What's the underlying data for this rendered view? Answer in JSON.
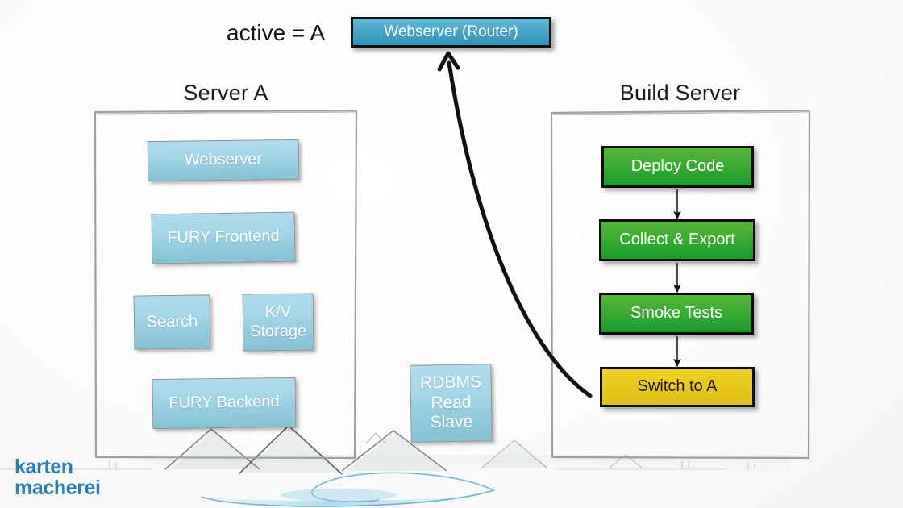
{
  "slide": {
    "annotation": "active = A",
    "logo": {
      "line1": "karten",
      "line2": "macherei",
      "color": "#2b7fae"
    }
  },
  "router": {
    "label": "Webserver (Router)",
    "fill_top": "#63b8d6",
    "fill_bottom": "#2e93b8"
  },
  "server_a": {
    "title": "Server A",
    "nodes": [
      {
        "label": "Webserver"
      },
      {
        "label": "FURY Frontend"
      },
      {
        "label": "Search"
      },
      {
        "label": "K/V\nStorage"
      },
      {
        "label": "FURY Backend"
      }
    ],
    "node_fill_top": "#aedced",
    "node_fill_bottom": "#85c2d8"
  },
  "standalone": {
    "rdbms": {
      "label": "RDBMS\nRead\nSlave"
    }
  },
  "build_server": {
    "title": "Build Server",
    "steps": [
      {
        "label": "Deploy Code",
        "color": "green"
      },
      {
        "label": "Collect & Export",
        "color": "green"
      },
      {
        "label": "Smoke Tests",
        "color": "green"
      },
      {
        "label": "Switch to A",
        "color": "yellow"
      }
    ],
    "green_fill_top": "#54b63a",
    "green_fill_bottom": "#189b2d",
    "yellow_fill_top": "#f0d02a",
    "yellow_fill_bottom": "#e0bd12"
  }
}
